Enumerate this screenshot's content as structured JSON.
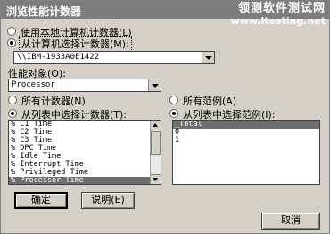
{
  "window": {
    "title": "浏览性能计数器",
    "watermark_line1": "领测软件测试网",
    "watermark_line2": "www.ltesting.net"
  },
  "computer_source": {
    "option_local": "使用本地计算机计数器(L)",
    "option_select": "从计算机选择计数器(M):",
    "selected_option": "option_select",
    "computer_value": "\\\\IBM-1933A0E1422"
  },
  "performance_object": {
    "label": "性能对象(O):",
    "value": "Processor"
  },
  "counters": {
    "option_all": "所有计数器(N)",
    "option_list": "从列表中选择计数器(T):",
    "selected_option": "option_list",
    "items": [
      "% C1 Time",
      "% C2 Time",
      "% C3 Time",
      "% DPC Time",
      "% Idle Time",
      "% Interrupt Time",
      "% Privileged Time",
      "% Processor Time"
    ],
    "selected_item": "% Processor Time"
  },
  "instances": {
    "option_all": "所有范例(A)",
    "option_list": "从列表中选择范例(I):",
    "selected_option": "option_list",
    "items": [
      "_Total",
      "0",
      "1"
    ],
    "selected_item": "_Total"
  },
  "buttons": {
    "ok": "确定",
    "explain": "说明(E)",
    "cancel": "取消"
  }
}
